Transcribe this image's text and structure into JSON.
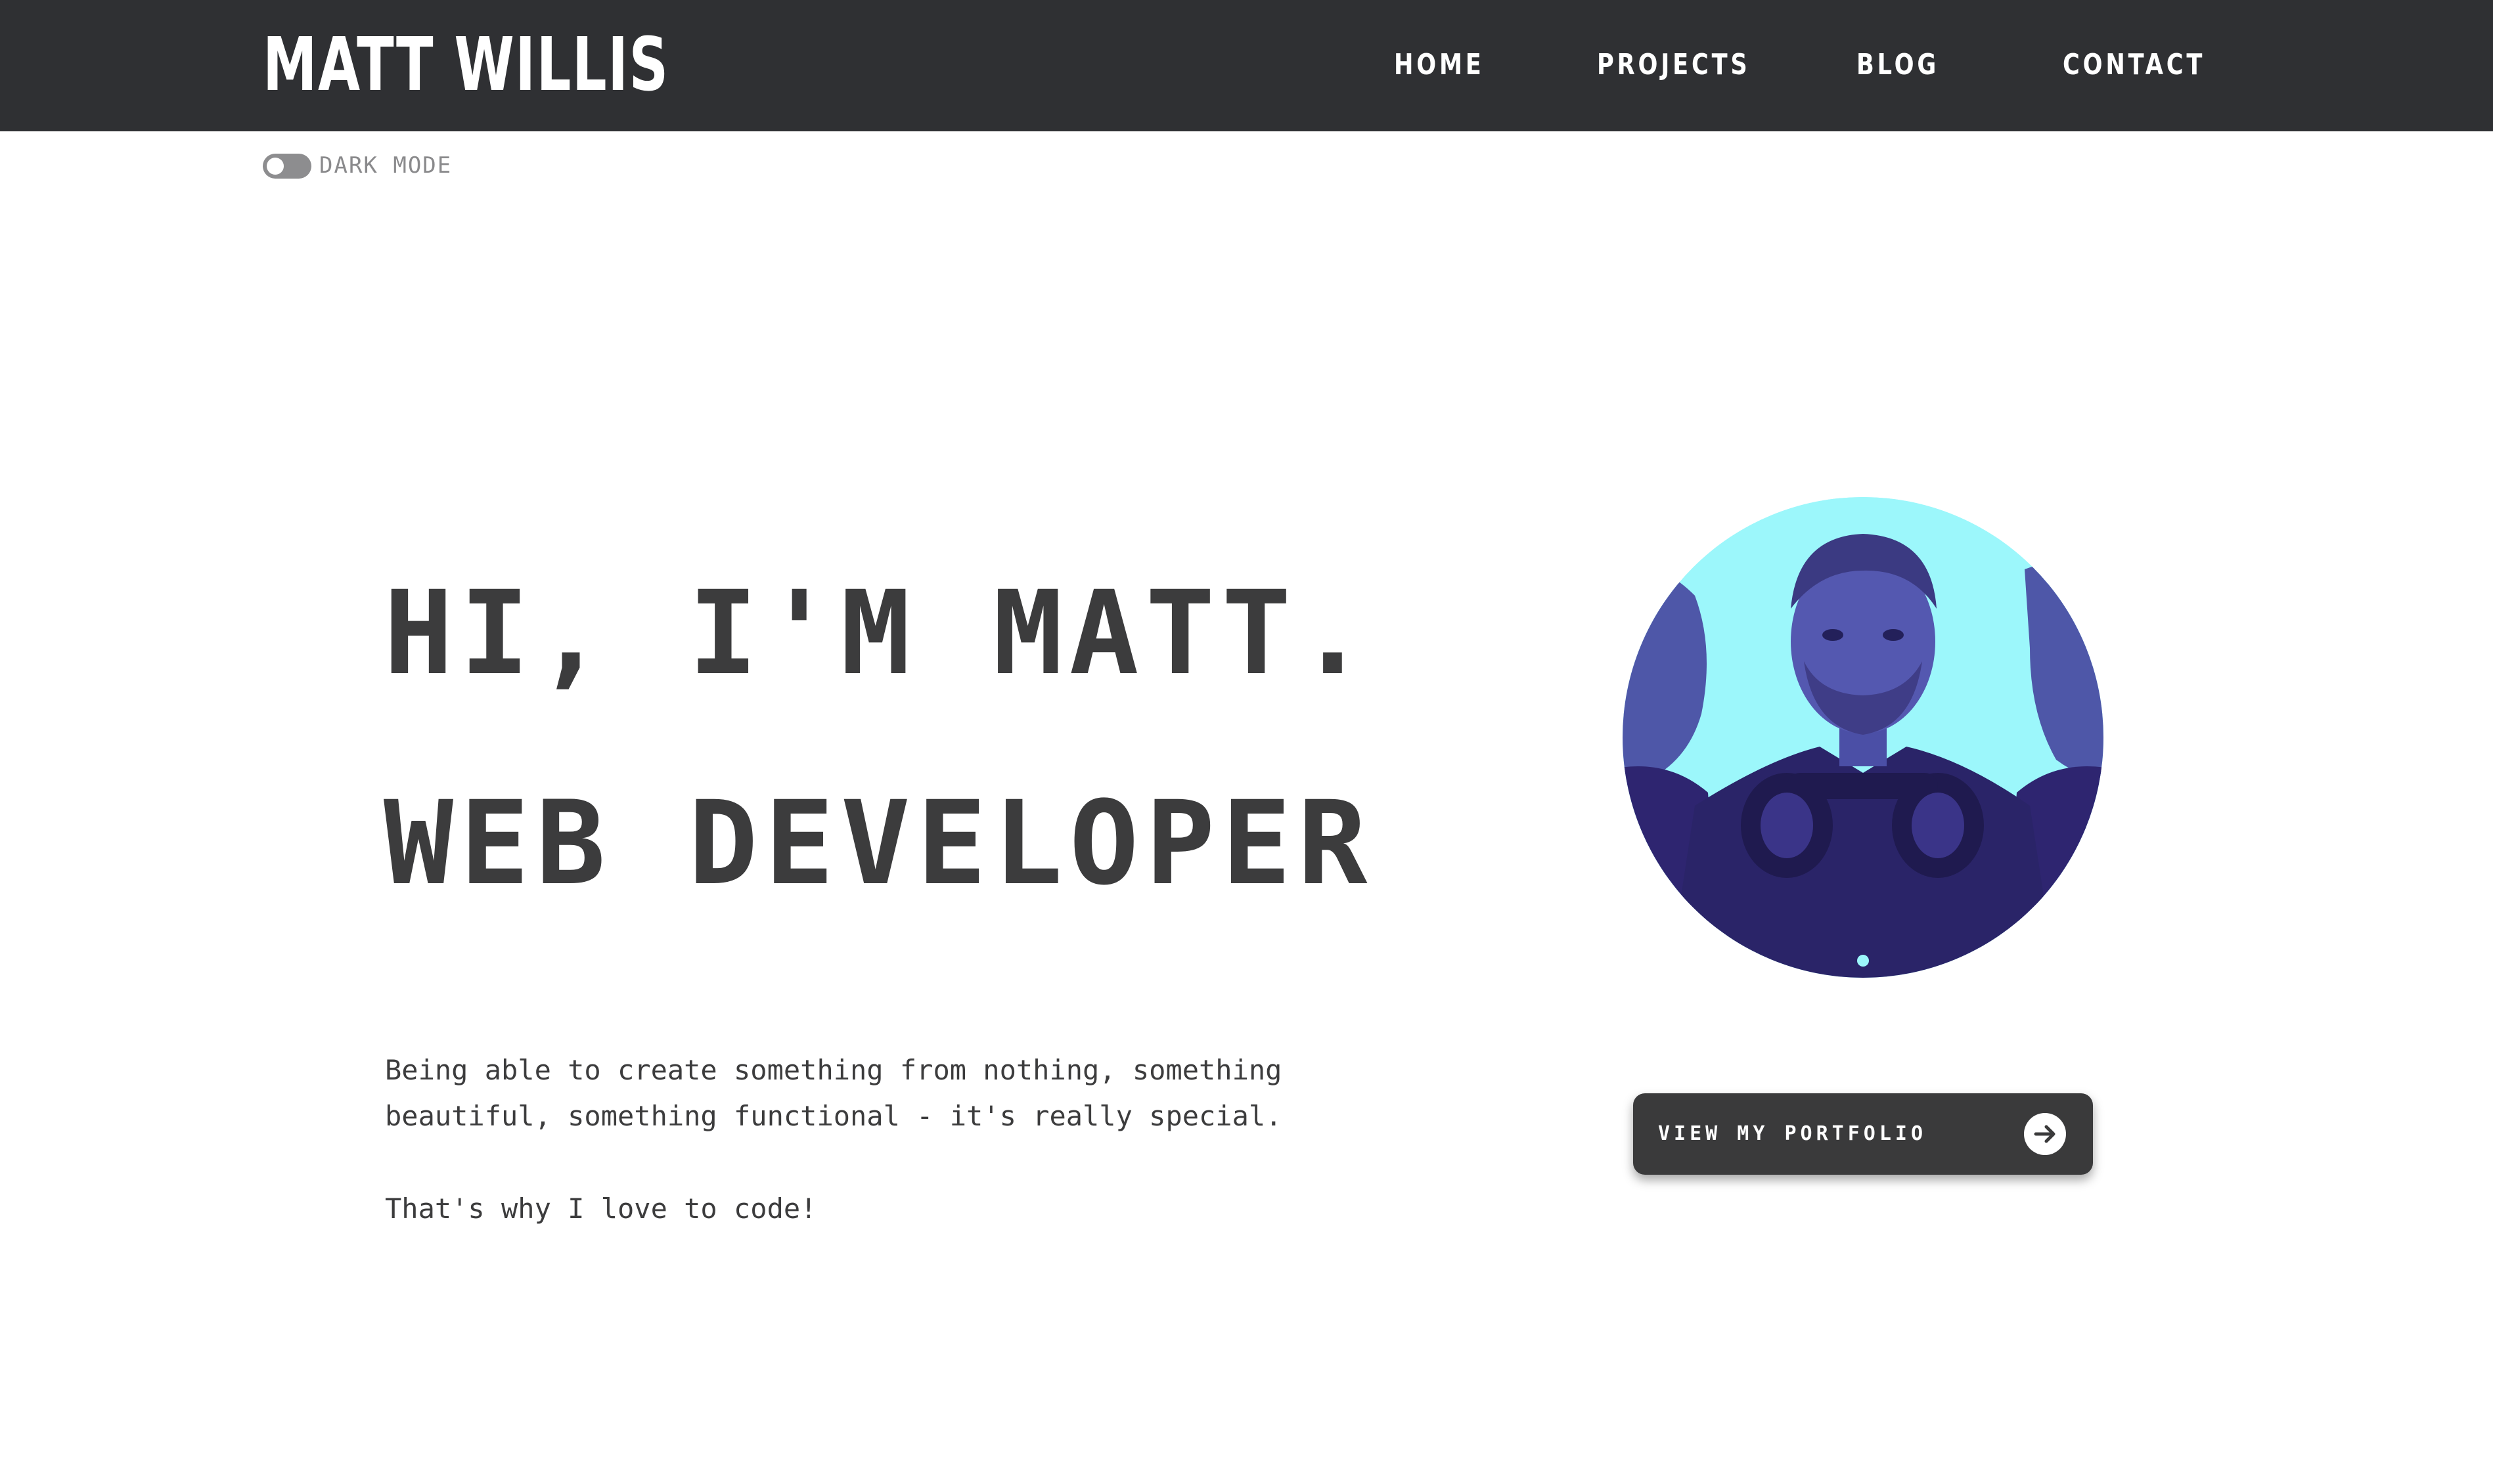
{
  "header": {
    "brand": "MATT WILLIS",
    "nav": [
      {
        "label": "HOME"
      },
      {
        "label": "PROJECTS"
      },
      {
        "label": "BLOG"
      },
      {
        "label": "CONTACT"
      }
    ]
  },
  "dark_mode": {
    "label": "DARK MODE",
    "enabled": false
  },
  "hero": {
    "line1": "HI, I'M MATT.",
    "line2": "WEB DEVELOPER",
    "paragraph1": "Being able to create something from nothing, something beautiful, something functional - it's really special.",
    "paragraph2": "That's why I love to code!"
  },
  "portrait": {
    "icon": "profile-photo",
    "background_color": "#9cf7fb",
    "tint_color": "#3a2f86"
  },
  "cta": {
    "label": "VIEW MY PORTFOLIO",
    "icon": "arrow-right-circle-icon"
  },
  "colors": {
    "header_bg": "#2f3033",
    "text": "#3c3c3d",
    "toggle": "#8d8d8f",
    "button_bg": "#3a3a3b"
  }
}
